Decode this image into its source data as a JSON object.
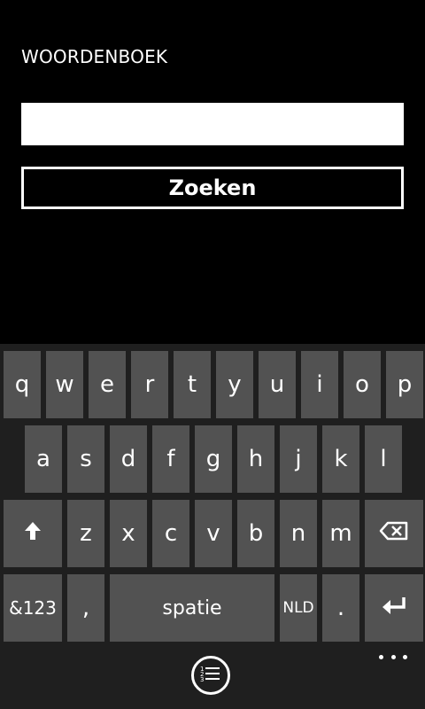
{
  "app": {
    "title": "WOORDENBOEK"
  },
  "search": {
    "value": "",
    "placeholder": ""
  },
  "buttons": {
    "search_label": "Zoeken"
  },
  "keyboard": {
    "row1": [
      "q",
      "w",
      "e",
      "r",
      "t",
      "y",
      "u",
      "i",
      "o",
      "p"
    ],
    "row2": [
      "a",
      "s",
      "d",
      "f",
      "g",
      "h",
      "j",
      "k",
      "l"
    ],
    "row3": [
      "z",
      "x",
      "c",
      "v",
      "b",
      "n",
      "m"
    ],
    "symbols_label": "&123",
    "comma_label": ",",
    "space_label": "spatie",
    "language_label": "NLD",
    "period_label": "."
  },
  "appbar": {
    "list_icon": "list-icon",
    "more_icon": "ellipsis-icon"
  }
}
